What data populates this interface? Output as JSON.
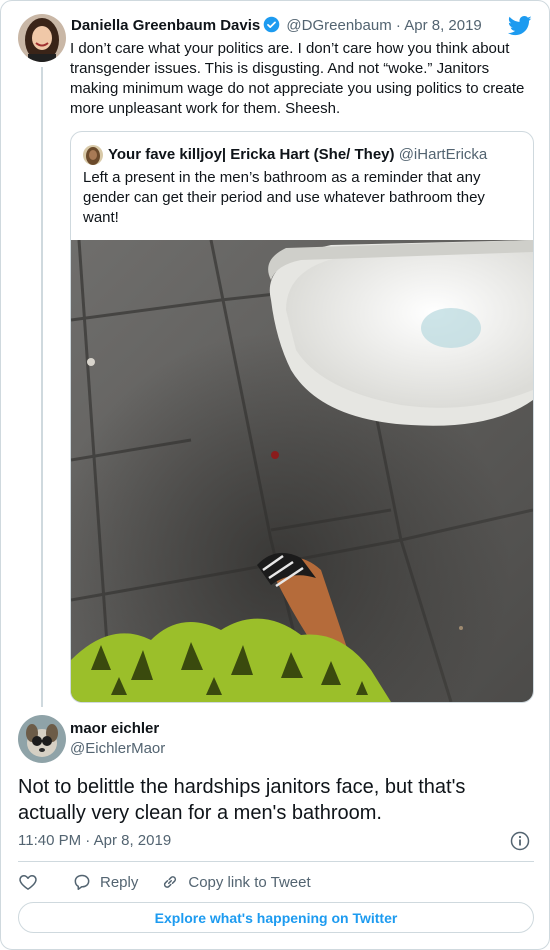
{
  "parent": {
    "name": "Daniella Greenbaum Davis",
    "handle": "@DGreenbaum",
    "separator": "·",
    "date": "Apr 8, 2019",
    "text": "I don’t care what your politics are. I don’t care how you think about transgender issues. This is disgusting. And not “woke.”  Janitors making minimum wage do not appreciate you using politics to create more unpleasant work for them. Sheesh."
  },
  "quote": {
    "name": "Your fave killjoy| Ericka Hart (She/ They)",
    "handle": "@iHartEricka",
    "text": "Left a present in the men’s bathroom as a reminder that any gender can get their period and use whatever bathroom they want!",
    "photo_description": "bathroom floor tiles beside toilet with blood drop"
  },
  "reply": {
    "name": "maor eichler",
    "handle": "@EichlerMaor",
    "text": "Not to belittle the hardships janitors face, but that's actually very clean for a men's bathroom.",
    "time": "11:40 PM",
    "separator": "·",
    "date": "Apr 8, 2019"
  },
  "actions": {
    "reply_label": "Reply",
    "copy_link_label": "Copy link to Tweet"
  },
  "explore_label": "Explore what's happening on Twitter",
  "icons": {
    "verified": "verified-badge-icon",
    "brand": "twitter-bird-icon",
    "info": "info-icon",
    "like": "heart-icon",
    "reply": "speech-bubble-icon",
    "copy": "link-icon"
  },
  "colors": {
    "accent": "#1d9bf0",
    "text": "#0f1419",
    "muted": "#536471",
    "border": "#cfd9de"
  }
}
